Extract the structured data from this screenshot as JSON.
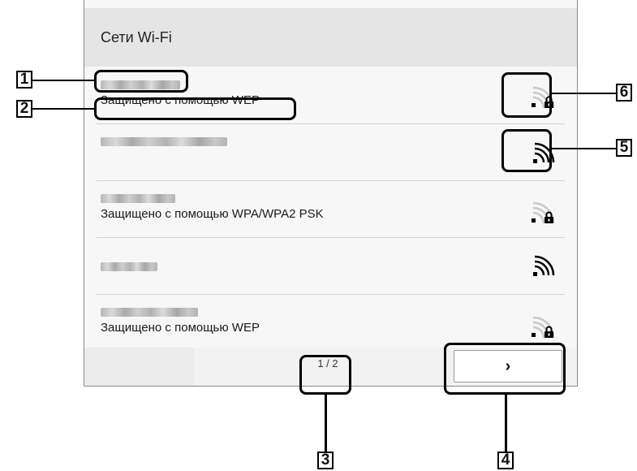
{
  "window_title": "Сети Wi-Fi",
  "networks": [
    {
      "security": "Защищено с помощью WEP",
      "signal_icon": "wifi-signal-locked-icon"
    },
    {
      "security": "",
      "signal_icon": "wifi-signal-icon"
    },
    {
      "security": "Защищено с помощью WPA/WPA2 PSK",
      "signal_icon": "wifi-signal-locked-icon"
    },
    {
      "security": "",
      "signal_icon": "wifi-signal-icon"
    },
    {
      "security": "Защищено с помощью WEP",
      "signal_icon": "wifi-signal-locked-icon"
    }
  ],
  "pagination": {
    "indicator": "1 / 2",
    "next_label": "›",
    "next_icon": "chevron-right-icon"
  },
  "callouts": [
    "1",
    "2",
    "3",
    "4",
    "5",
    "6"
  ],
  "colors": {
    "header_bg": "#e5e5e5",
    "list_bg": "#f7f7f7",
    "callout": "#000000"
  }
}
